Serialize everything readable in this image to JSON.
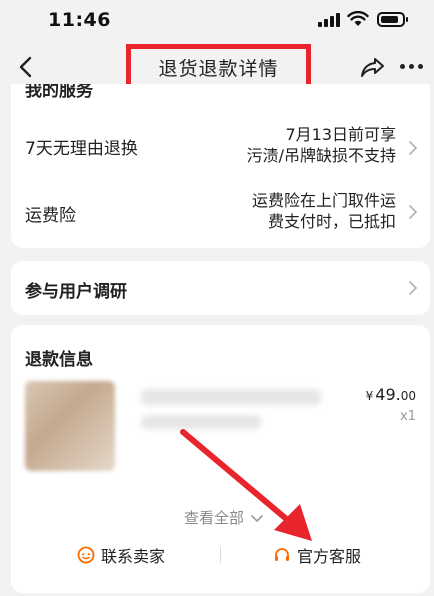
{
  "status_bar": {
    "time": "11:46"
  },
  "nav": {
    "title": "退货退款详情"
  },
  "services": {
    "section_title": "我的服务",
    "items": [
      {
        "label": "7天无理由退换",
        "value_lines": [
          "7月13日前可享",
          "污渍/吊牌缺损不支持"
        ]
      },
      {
        "label": "运费险",
        "value_lines": [
          "运费险在上门取件运",
          "费支付时，已抵扣"
        ]
      }
    ]
  },
  "survey": {
    "label": "参与用户调研"
  },
  "refund": {
    "title": "退款信息",
    "price_symbol": "¥",
    "price_int": "49.",
    "price_dec": "00",
    "quantity": "x1",
    "view_all": "查看全部",
    "contact_seller": "联系卖家",
    "official_service": "官方客服"
  },
  "colors": {
    "highlight_box": "#e8252d",
    "annotation_arrow": "#e8252d",
    "action_icon": "#ff6a00"
  }
}
